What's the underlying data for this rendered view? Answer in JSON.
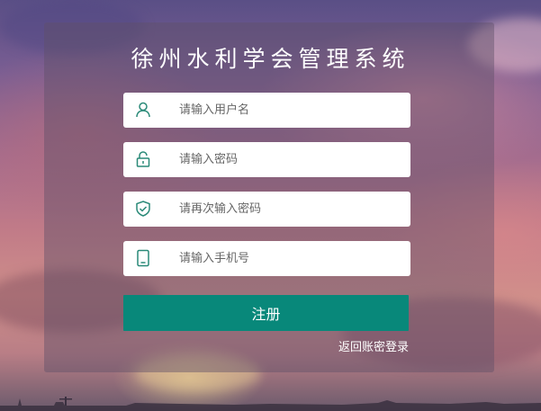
{
  "title": "徐州水利学会管理系统",
  "fields": [
    {
      "placeholder": "请输入用户名",
      "icon": "user-icon"
    },
    {
      "placeholder": "请输入密码",
      "icon": "lock-icon"
    },
    {
      "placeholder": "请再次输入密码",
      "icon": "shield-check-icon"
    },
    {
      "placeholder": "请输入手机号",
      "icon": "phone-icon"
    }
  ],
  "register_label": "注册",
  "back_link_label": "返回账密登录",
  "colors": {
    "accent": "#08887a",
    "icon": "#2a8a78",
    "panel": "rgba(95,80,105,0.45)"
  }
}
